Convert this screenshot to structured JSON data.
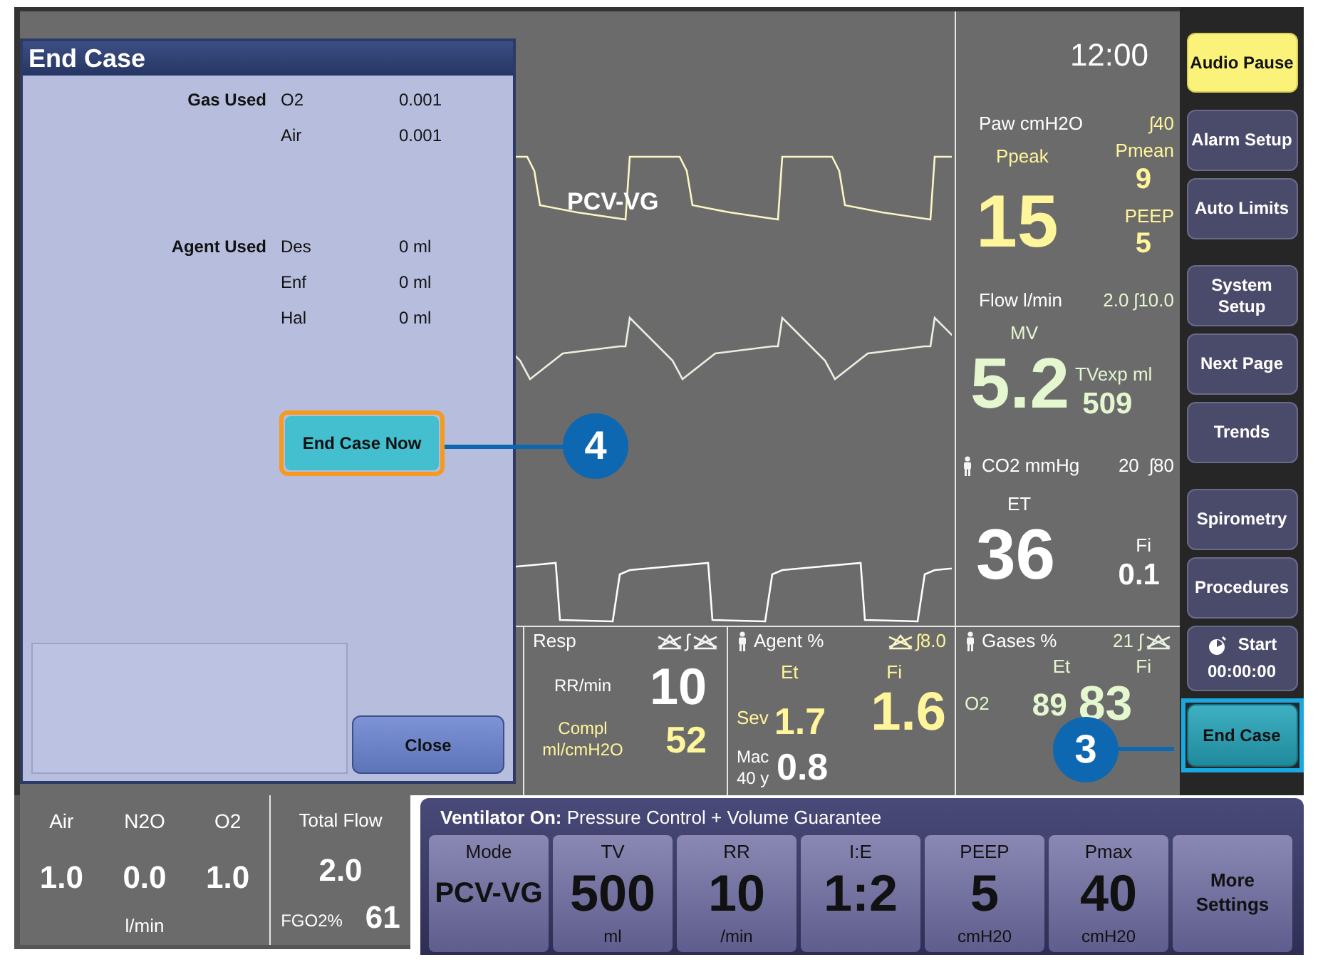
{
  "clock": "12:00",
  "waveform_label": "PCV-VG",
  "paw": {
    "title": "Paw cmH2O",
    "limit": "ʃ40",
    "main_label": "Ppeak",
    "main_value": "15",
    "side": [
      {
        "label": "Pmean",
        "value": "9"
      },
      {
        "label": "PEEP",
        "value": "5"
      }
    ]
  },
  "flow": {
    "title": "Flow l/min",
    "limit": "2.0 ʃ10.0",
    "main_label": "MV",
    "main_value": "5.2",
    "side_label": "TVexp ml",
    "side_value": "509"
  },
  "co2": {
    "title": "CO2 mmHg",
    "limit": "20  ʃ80",
    "main_label": "ET",
    "main_value": "36",
    "side_label": "Fi",
    "side_value": "0.1"
  },
  "resp": {
    "title": "Resp",
    "limit_mid": "ʃ",
    "rows": [
      {
        "label": "RR/min",
        "value": "10",
        "kind": "white"
      },
      {
        "label": "Compl ml/cmH2O",
        "value": "52",
        "kind": "yellow"
      }
    ]
  },
  "agent": {
    "title": "Agent %",
    "limit": "ʃ8.0",
    "et_label": "Et",
    "fi_label": "Fi",
    "agent": "Sev",
    "et": "1.7",
    "fi": "1.6",
    "mac_label": "Mac 40 y",
    "mac": "0.8"
  },
  "gases": {
    "title": "Gases %",
    "limit": "21 ʃ",
    "et_label": "Et",
    "fi_label": "Fi",
    "gas": "O2",
    "et": "89",
    "fi": "83"
  },
  "flows": {
    "gases": [
      {
        "name": "Air",
        "value": "1.0"
      },
      {
        "name": "N2O",
        "value": "0.0"
      },
      {
        "name": "O2",
        "value": "1.0"
      }
    ],
    "unit": "l/min",
    "total_label": "Total Flow",
    "total": "2.0",
    "fgo2_label": "FGO2%",
    "fgo2": "61"
  },
  "dialog": {
    "title": "End Case",
    "sections": [
      {
        "label": "Gas Used",
        "rows": [
          {
            "name": "O2",
            "value": "0.001"
          },
          {
            "name": "Air",
            "value": "0.001"
          }
        ]
      },
      {
        "label": "Agent Used",
        "rows": [
          {
            "name": "Des",
            "value": "0 ml"
          },
          {
            "name": "Enf",
            "value": "0 ml"
          },
          {
            "name": "Hal",
            "value": "0 ml"
          }
        ]
      }
    ],
    "action": "End Case Now",
    "close": "Close"
  },
  "side_buttons": [
    {
      "label": "Audio Pause",
      "kind": "alert"
    },
    {
      "label": "Alarm Setup",
      "kind": "normal"
    },
    {
      "label": "Auto Limits",
      "kind": "normal"
    },
    {
      "label": "System Setup",
      "kind": "normal"
    },
    {
      "label": "Next Page",
      "kind": "normal"
    },
    {
      "label": "Trends",
      "kind": "normal"
    },
    {
      "label": "Spirometry",
      "kind": "normal"
    },
    {
      "label": "Procedures",
      "kind": "normal"
    },
    {
      "label": "Start",
      "time": "00:00:00",
      "kind": "timer"
    },
    {
      "label": "End Case",
      "kind": "highlight"
    }
  ],
  "ventilator": {
    "status": "**Ventilator On:** Pressure Control + Volume Guarantee",
    "settings": [
      {
        "label": "Mode",
        "value": "PCV-VG"
      },
      {
        "label": "TV",
        "value": "500",
        "unit": "ml"
      },
      {
        "label": "RR",
        "value": "10",
        "unit": "/min"
      },
      {
        "label": "I:E",
        "value": "1:2"
      },
      {
        "label": "PEEP",
        "value": "5",
        "unit": "cmH20"
      },
      {
        "label": "Pmax",
        "value": "40",
        "unit": "cmH20"
      },
      {
        "label": "More Settings",
        "kind": "more"
      }
    ]
  },
  "callouts": [
    "4",
    "3"
  ]
}
